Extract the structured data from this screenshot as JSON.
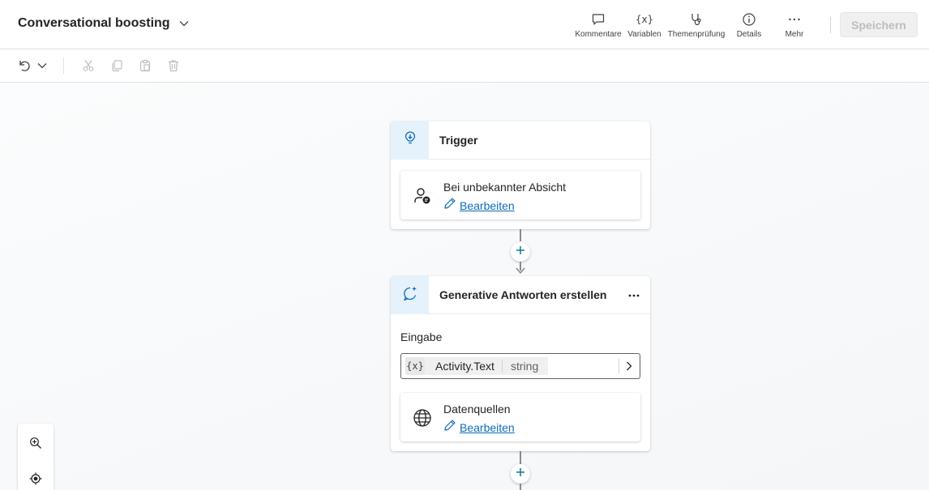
{
  "header": {
    "title": "Conversational boosting",
    "tools": [
      {
        "label": "Kommentare",
        "icon": "comment-icon"
      },
      {
        "label": "Variablen",
        "icon": "variable-icon"
      },
      {
        "label": "Themenprüfung",
        "icon": "stethoscope-icon"
      },
      {
        "label": "Details",
        "icon": "info-icon"
      },
      {
        "label": "Mehr",
        "icon": "more-icon"
      }
    ],
    "save_label": "Speichern"
  },
  "toolbar": {
    "buttons": [
      "undo-icon",
      "chevron-down-icon",
      "cut-icon",
      "copy-icon",
      "paste-icon",
      "delete-icon"
    ]
  },
  "trigger_node": {
    "title": "Trigger",
    "card": {
      "title": "Bei unbekannter Absicht",
      "link": "Bearbeiten"
    }
  },
  "generative_node": {
    "title": "Generative Antworten erstellen",
    "input_label": "Eingabe",
    "variable": {
      "prefix": "{x}",
      "name": "Activity.Text",
      "type": "string"
    },
    "datasources": {
      "title": "Datenquellen",
      "link": "Bearbeiten"
    }
  },
  "colors": {
    "accent": "#0f6cbd",
    "node_icon_bg": "#e6f2fb",
    "add_plus": "#0e7a8a"
  }
}
